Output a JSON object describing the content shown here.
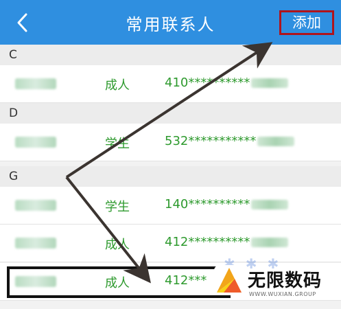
{
  "header": {
    "title": "常用联系人",
    "add_label": "添加"
  },
  "sections": [
    {
      "letter": "C",
      "contacts": [
        {
          "type": "成人",
          "id_prefix": "410**********"
        }
      ]
    },
    {
      "letter": "D",
      "contacts": [
        {
          "type": "学生",
          "id_prefix": "532***********"
        }
      ]
    },
    {
      "letter": "G",
      "contacts": [
        {
          "type": "学生",
          "id_prefix": "140**********"
        },
        {
          "type": "成人",
          "id_prefix": "412**********"
        },
        {
          "type": "成人",
          "id_prefix": "412***"
        }
      ]
    }
  ],
  "watermark": {
    "title": "无限数码",
    "subtitle": "WWW.WUXIAN.GROUP"
  },
  "colors": {
    "header": "#2f8fe0",
    "accent_green": "#2e9a2e",
    "highlight_red": "#b0141c",
    "annotation": "#3b3430"
  }
}
